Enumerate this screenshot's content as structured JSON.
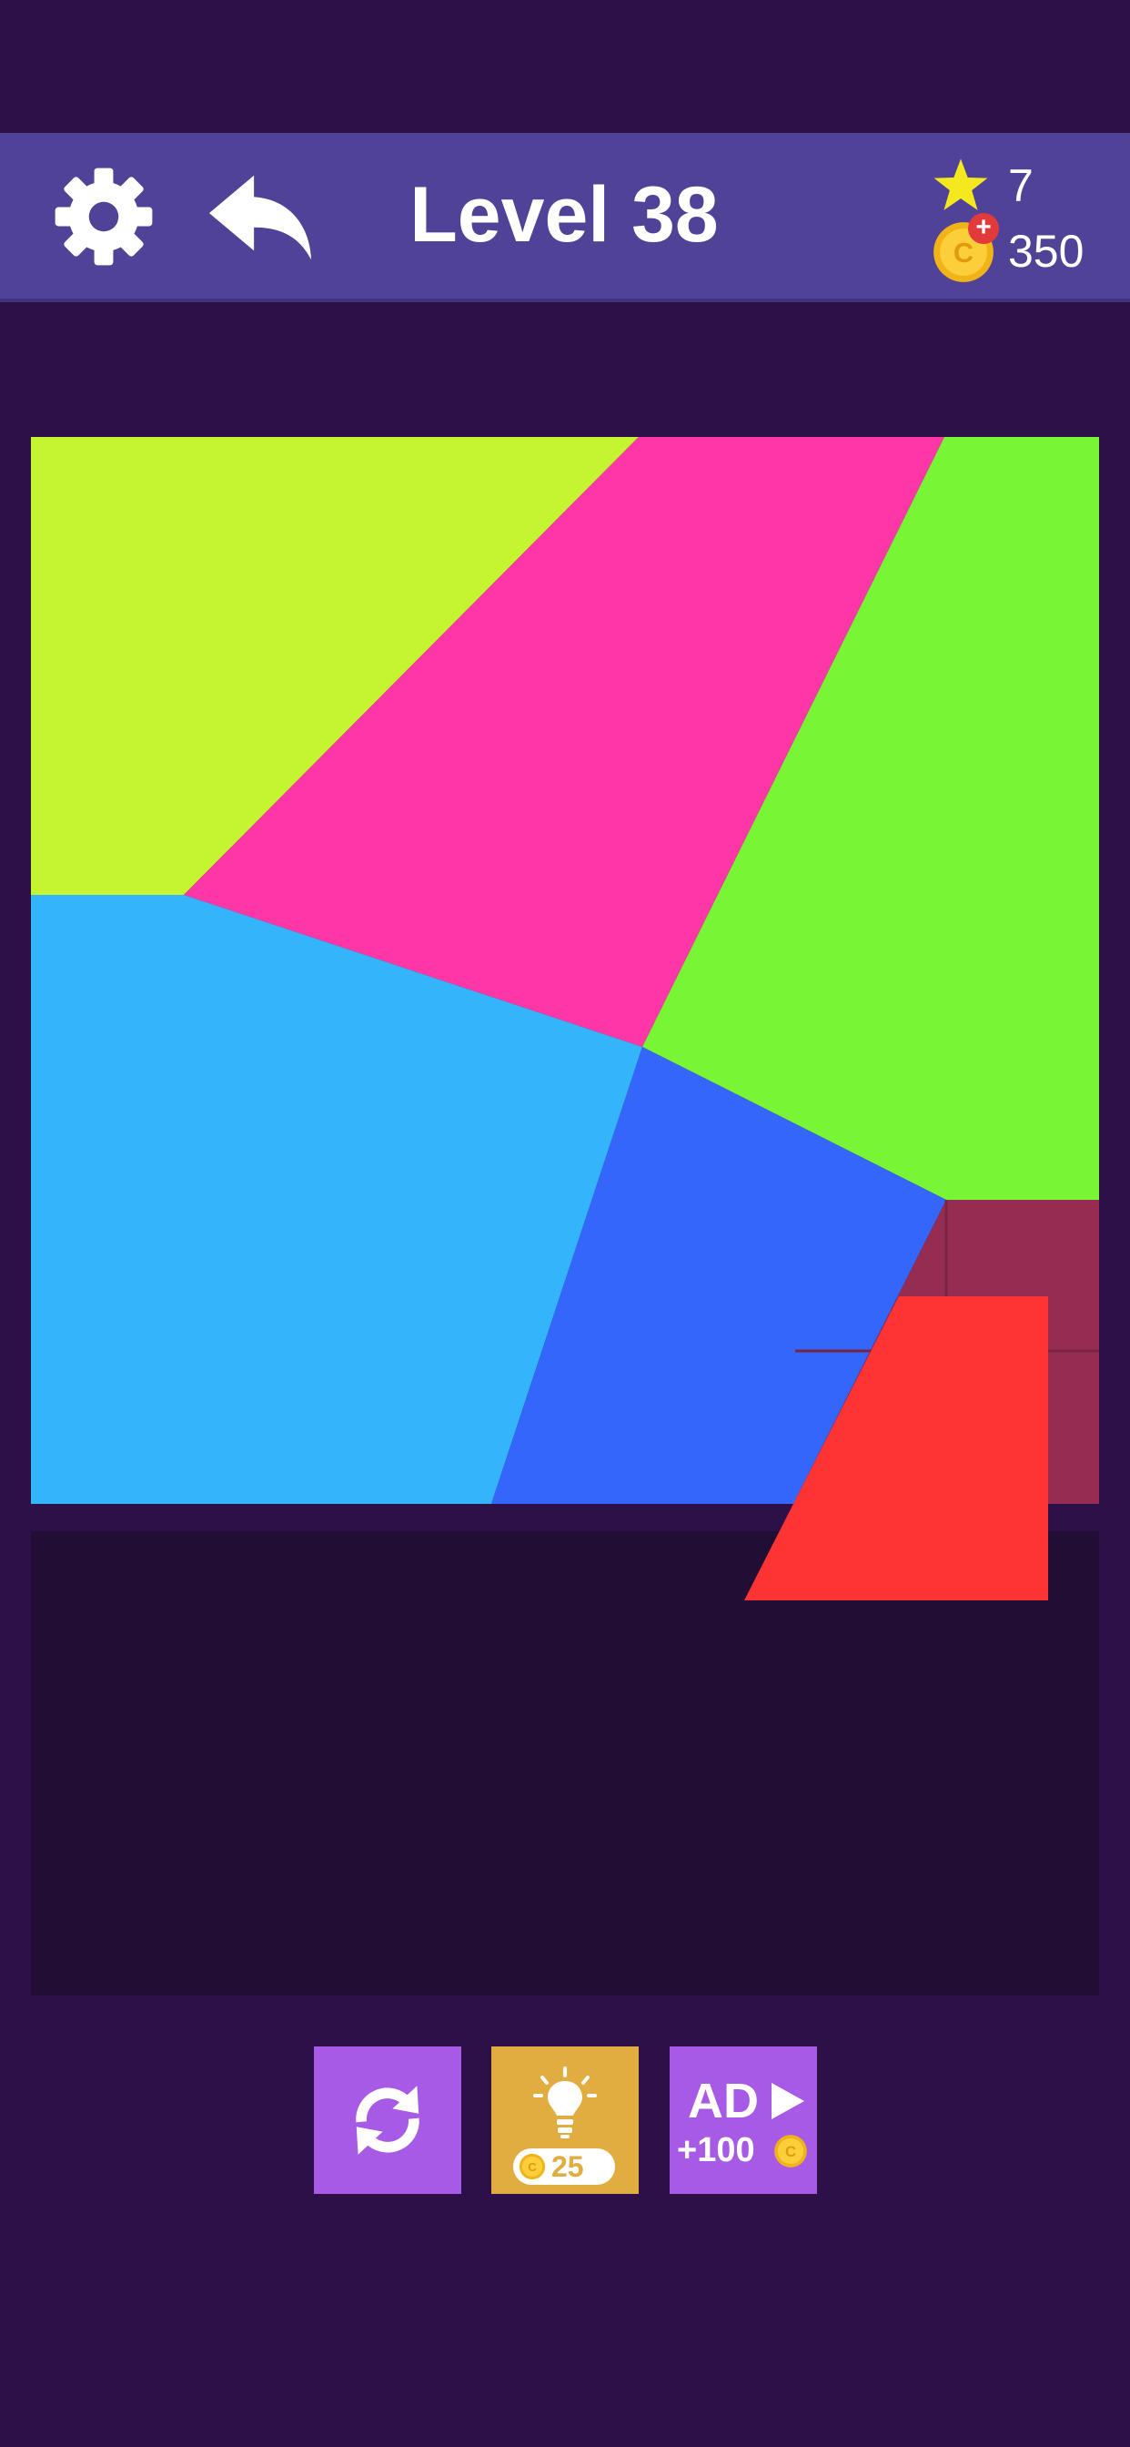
{
  "header": {
    "level_title": "Level 38",
    "stars": "7",
    "coins": "350",
    "coin_plus": "+",
    "icons": [
      "gear-icon",
      "undo-arrow-icon",
      "star-icon",
      "coin-icon"
    ]
  },
  "coin_symbol": "C",
  "buttons": {
    "reset": {
      "icon": "refresh-icon"
    },
    "hint": {
      "icon": "lightbulb-icon",
      "price": "25"
    },
    "ad": {
      "label": "AD",
      "reward": "+100",
      "icon": "play-icon"
    }
  },
  "colors": {
    "background": "#2c1047",
    "header": "#504296",
    "tray": "#220d34",
    "piece_lime": "#c5f530",
    "piece_pink": "#ff36a6",
    "piece_green": "#78f534",
    "piece_sky": "#33b4fb",
    "piece_blue": "#3566fb",
    "piece_red": "#fe3434",
    "empty_slot": "#952d52"
  }
}
